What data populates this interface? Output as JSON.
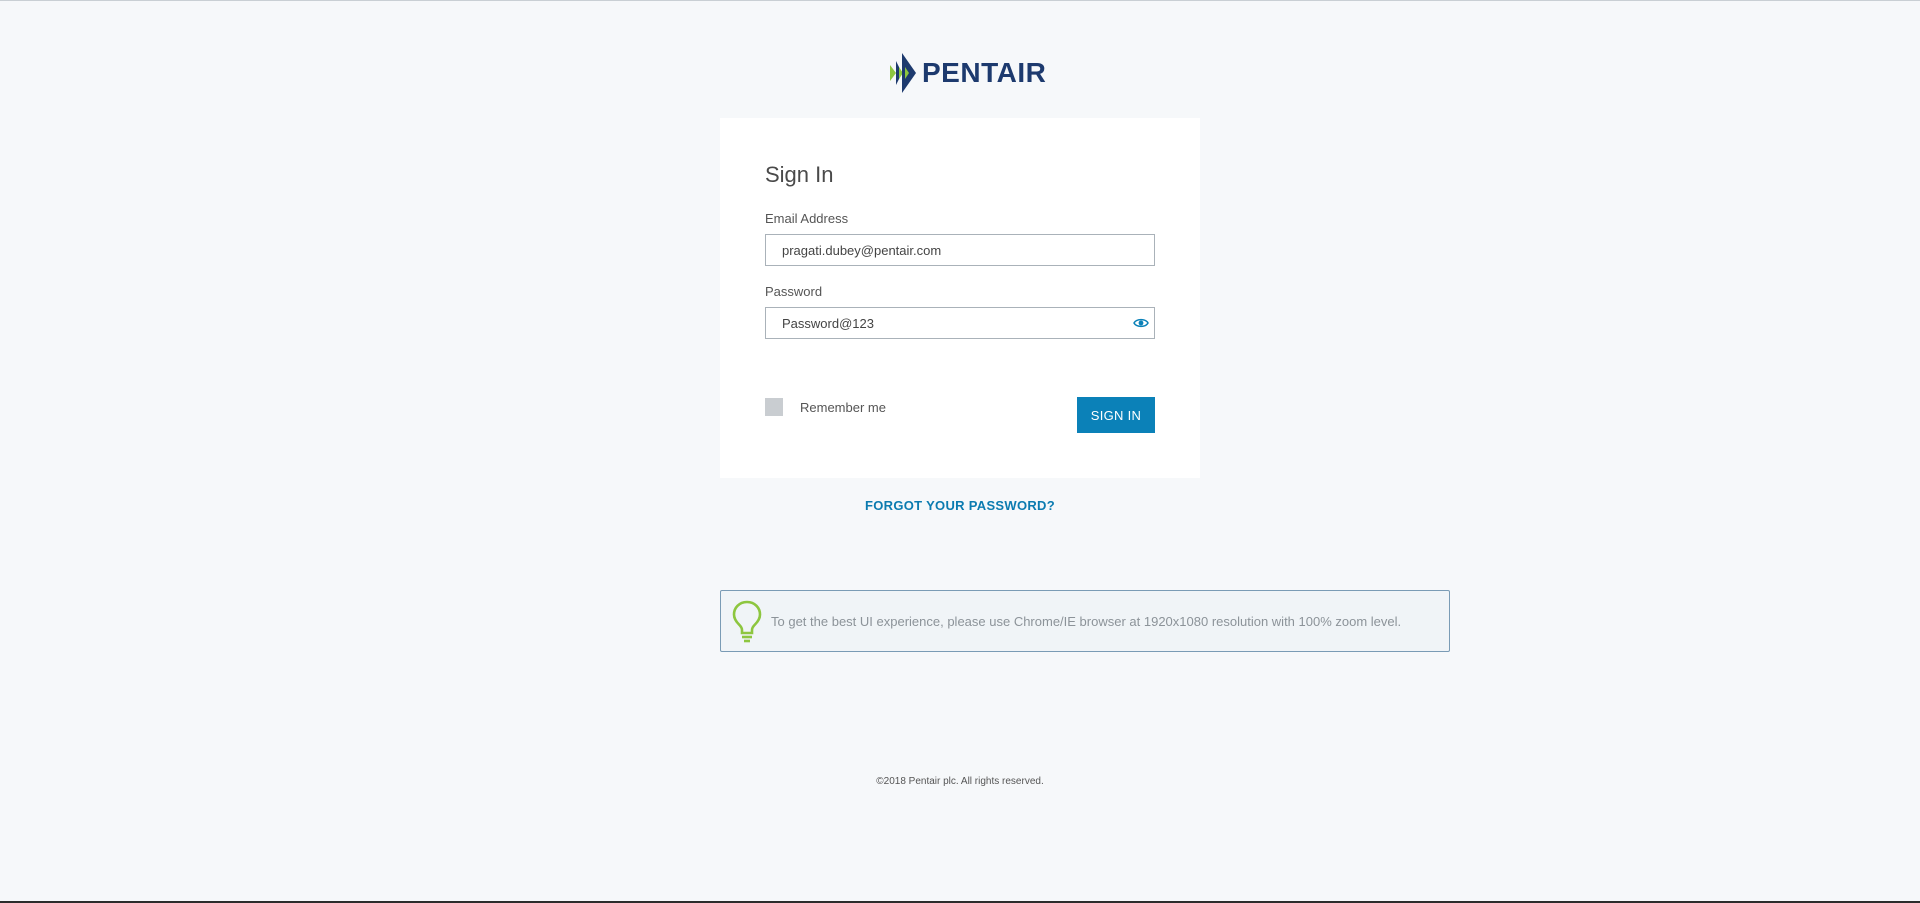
{
  "brand": {
    "name": "PENTAIR",
    "color": "#1d3a6e",
    "accent": "#8dc63f"
  },
  "signin": {
    "title": "Sign In",
    "email_label": "Email Address",
    "email_value": "pragati.dubey@pentair.com",
    "password_label": "Password",
    "password_value": "Password@123",
    "password_toggle_icon": "eye-icon",
    "remember_label": "Remember me",
    "remember_checked": false,
    "submit_label": "SIGN IN",
    "button_color": "#0b81b8"
  },
  "forgot_link": "FORGOT YOUR PASSWORD?",
  "tip": {
    "icon": "lightbulb-icon",
    "text": "To get the best UI experience, please use Chrome/IE browser at 1920x1080 resolution with 100% zoom level."
  },
  "footer": {
    "copyright": "©2018 Pentair plc. All rights reserved."
  }
}
